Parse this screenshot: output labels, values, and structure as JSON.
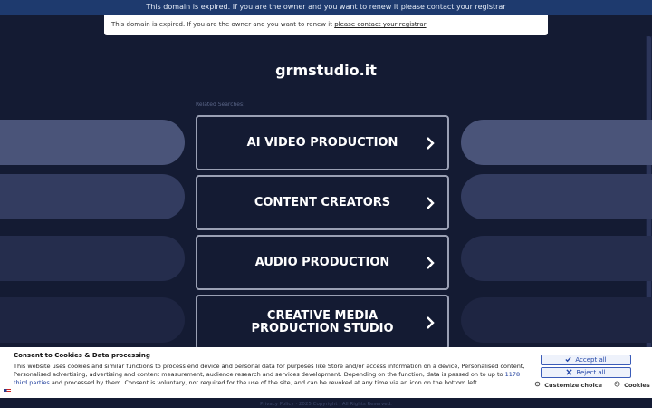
{
  "banner": {
    "text": "This domain is expired. If you are the owner and you want to renew it please contact your registrar"
  },
  "notice": {
    "text": "This domain is expired. If you are the owner and you want to renew it ",
    "link": "please contact your registrar"
  },
  "site": {
    "domain": "grmstudio.it",
    "related_label": "Related Searches:"
  },
  "searches": [
    {
      "label": "AI VIDEO PRODUCTION"
    },
    {
      "label": "CONTENT CREATORS"
    },
    {
      "label": "AUDIO PRODUCTION"
    },
    {
      "label": "CREATIVE MEDIA PRODUCTION STUDIO"
    }
  ],
  "consent": {
    "title": "Consent to Cookies & Data processing",
    "text_before": "This website uses cookies and similar functions to process end device and personal data for purposes like Store and/or access information on a device, Personalised content, Personalised advertising, advertising and content measurement, audience research and services development. Depending on the function, data is passed on to up to ",
    "link": "1178 third parties",
    "text_after": " and processed by them. Consent is voluntary, not required for the use of the site, and can be revoked at any time via an icon on the bottom left.",
    "accept_label": "Accept all",
    "reject_label": "Reject all",
    "customize_label": "Customize choice",
    "separator": "|",
    "cookies_label": "Cookies"
  },
  "footer": {
    "text": "Privacy Policy · 2025 Copyright | All Rights Reserved."
  },
  "colors": {
    "background": "#141b33",
    "accent": "#2447a8",
    "card_border": "#9aa0b4"
  },
  "icons": [
    "chevron-right-icon",
    "check-icon",
    "x-icon",
    "gear-icon",
    "cookie-icon",
    "flag-icon"
  ]
}
